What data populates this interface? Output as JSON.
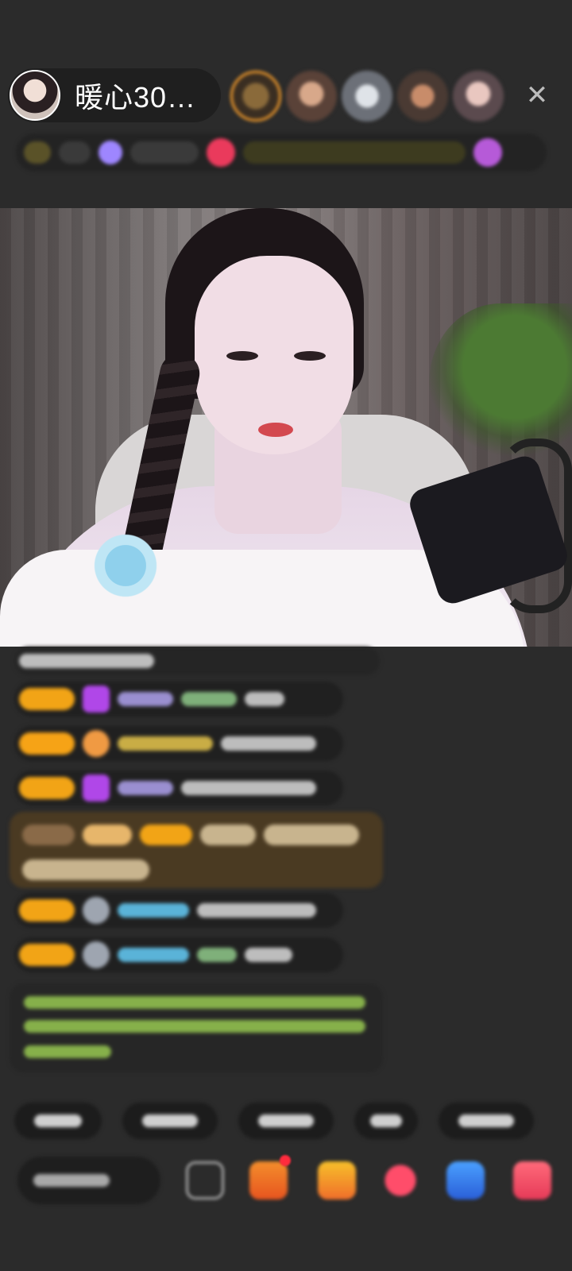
{
  "host": {
    "name": "暖心30…",
    "avatar_icon": "host-avatar"
  },
  "viewers": {
    "avatars": [
      "viewer-avatar-1",
      "viewer-avatar-2",
      "viewer-avatar-3",
      "viewer-avatar-4",
      "viewer-avatar-5"
    ],
    "close_icon_glyph": "✕"
  },
  "colors": {
    "background": "#2b2b2b",
    "level_badge": "#f2a416",
    "highlight_message": "#4a3a22",
    "system_message_text": "#86b04a"
  },
  "bottom_bar": {
    "icons": [
      "emoji-icon",
      "gift-box-icon",
      "gift-icon",
      "heart-icon",
      "game-icon",
      "treasure-icon"
    ]
  }
}
